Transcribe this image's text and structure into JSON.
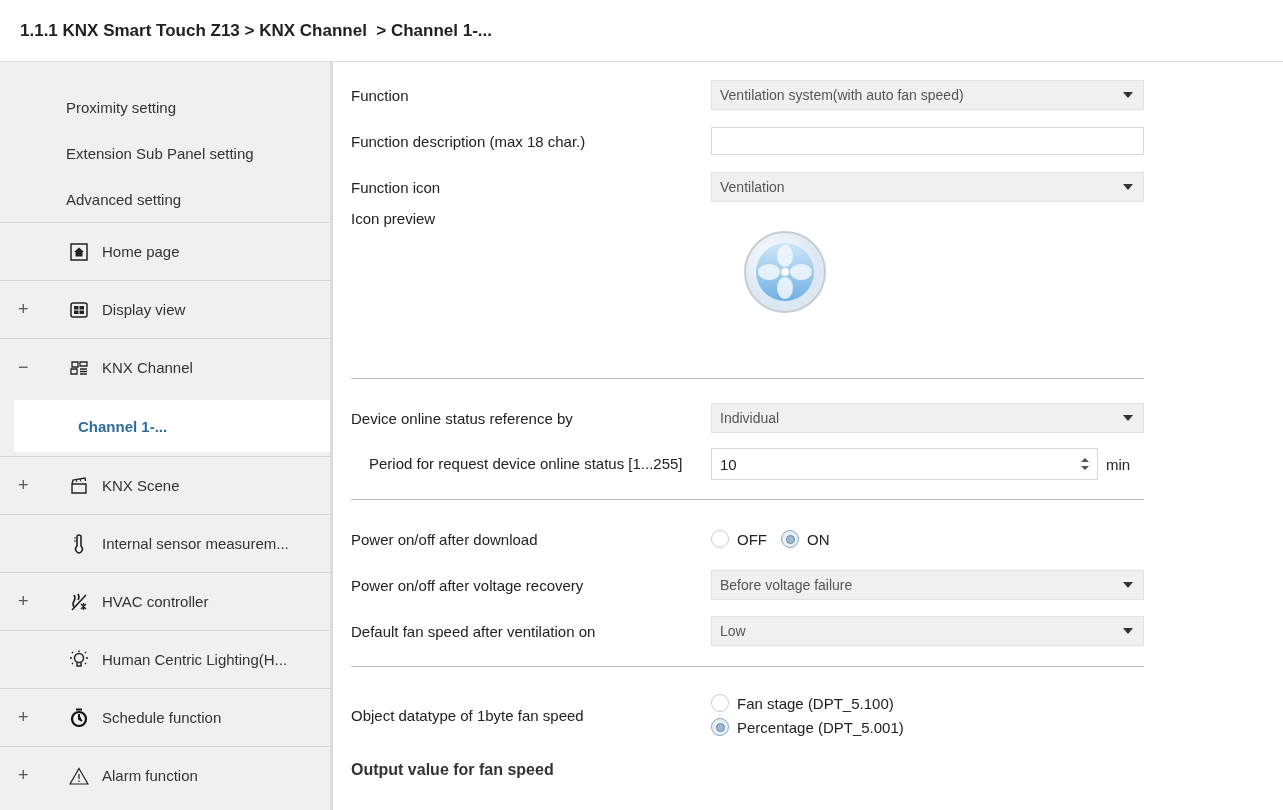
{
  "breadcrumb": "1.1.1 KNX Smart Touch Z13 > KNX Channel  > Channel 1-...",
  "sidebar": {
    "items": [
      {
        "kind": "sub",
        "label": "Proximity setting",
        "selected": false
      },
      {
        "kind": "sub",
        "label": "Extension Sub Panel setting",
        "selected": false
      },
      {
        "kind": "sub",
        "label": "Advanced setting",
        "selected": false
      },
      {
        "kind": "node",
        "label": "Home page",
        "selected": false
      },
      {
        "kind": "node",
        "toggle": "+",
        "label": "Display view",
        "selected": false
      },
      {
        "kind": "node",
        "toggle": "−",
        "label": "KNX Channel",
        "selected": false
      },
      {
        "kind": "child",
        "label": "Channel 1-...",
        "selected": true
      },
      {
        "kind": "node",
        "toggle": "+",
        "label": "KNX Scene",
        "selected": false
      },
      {
        "kind": "node",
        "label": "Internal sensor measurem...",
        "selected": false
      },
      {
        "kind": "node",
        "toggle": "+",
        "label": "HVAC controller",
        "selected": false
      },
      {
        "kind": "node",
        "label": "Human Centric Lighting(H...",
        "selected": false
      },
      {
        "kind": "node",
        "toggle": "+",
        "label": "Schedule function",
        "selected": false
      },
      {
        "kind": "node",
        "toggle": "+",
        "label": "Alarm function",
        "selected": false
      }
    ]
  },
  "form": [
    {
      "kind": "dropdown",
      "label": "Function",
      "value": "Ventilation system(with auto fan speed)"
    },
    {
      "kind": "text",
      "label": "Function description (max 18 char.)"
    },
    {
      "kind": "dropdown",
      "label": "Function icon",
      "value": "Ventilation"
    },
    {
      "kind": "preview",
      "label": "Icon preview"
    },
    {
      "kind": "divider"
    },
    {
      "kind": "dropdown",
      "label": "Device online status reference by",
      "value": "Individual"
    },
    {
      "kind": "spin",
      "label": "Period for request device online status [1...255]",
      "value": "10",
      "unit": "min"
    },
    {
      "kind": "divider"
    },
    {
      "kind": "radio",
      "label": "Power on/off after download",
      "inline": true,
      "options": [
        {
          "label": "OFF",
          "selected": false
        },
        {
          "label": "ON",
          "selected": true
        }
      ]
    },
    {
      "kind": "dropdown",
      "label": "Power on/off after voltage recovery",
      "value": "Before voltage failure"
    },
    {
      "kind": "dropdown",
      "label": "Default fan speed after ventilation on",
      "value": "Low"
    },
    {
      "kind": "divider"
    },
    {
      "kind": "radio",
      "label": "Object datatype of 1byte fan speed",
      "inline": false,
      "options": [
        {
          "label": "Fan stage (DPT_5.100)",
          "selected": false
        },
        {
          "label": "Percentage (DPT_5.001)",
          "selected": true
        }
      ]
    },
    {
      "kind": "heading",
      "label": "Output value for fan speed"
    }
  ]
}
